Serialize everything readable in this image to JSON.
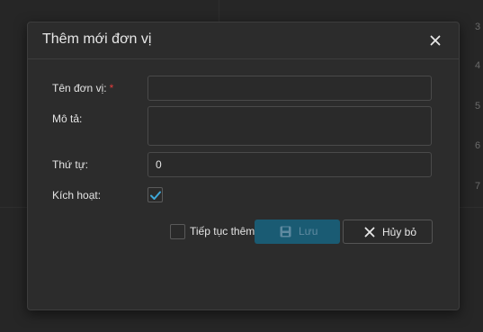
{
  "background": {
    "row_numbers": [
      "3",
      "4",
      "5",
      "6",
      "7"
    ]
  },
  "dialog": {
    "title": "Thêm mới đơn vị",
    "close_icon": "close-icon",
    "fields": {
      "name": {
        "label": "Tên đơn vị:",
        "required_mark": "*",
        "value": ""
      },
      "description": {
        "label": "Mô tả:",
        "value": ""
      },
      "order": {
        "label": "Thứ tự:",
        "value": "0"
      },
      "active": {
        "label": "Kích hoạt:",
        "checked": true
      }
    },
    "footer": {
      "continue_label": "Tiếp tục thêm",
      "continue_checked": false,
      "save_label": "Lưu",
      "save_icon": "save-icon",
      "cancel_label": "Hủy bỏ",
      "cancel_icon": "close-icon"
    }
  },
  "colors": {
    "background": "#262626",
    "dialog": "#2c2c2c",
    "accent": "#1a5b73",
    "check": "#3ea7d8",
    "required": "#e23c3c"
  }
}
